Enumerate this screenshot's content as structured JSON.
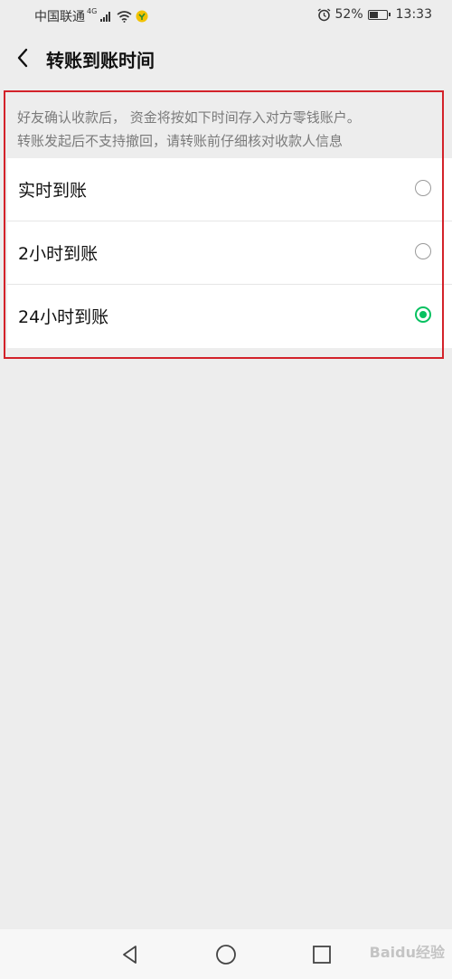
{
  "status_bar": {
    "carrier": "中国联通",
    "network": "4G",
    "battery_percent": "52%",
    "battery_level": 0.52,
    "time": "13:33"
  },
  "header": {
    "back_icon": "chevron-left-icon",
    "title": "转账到账时间"
  },
  "info": {
    "line1": "好友确认收款后， 资金将按如下时间存入对方零钱账户。",
    "line2": "转账发起后不支持撤回，请转账前仔细核对收款人信息"
  },
  "options": [
    {
      "label": "实时到账",
      "selected": false
    },
    {
      "label": "2小时到账",
      "selected": false
    },
    {
      "label": "24小时到账",
      "selected": true
    }
  ],
  "colors": {
    "accent": "#07c160",
    "highlight": "#d3222a",
    "background": "#ededed"
  },
  "watermark": "Baidu经验"
}
